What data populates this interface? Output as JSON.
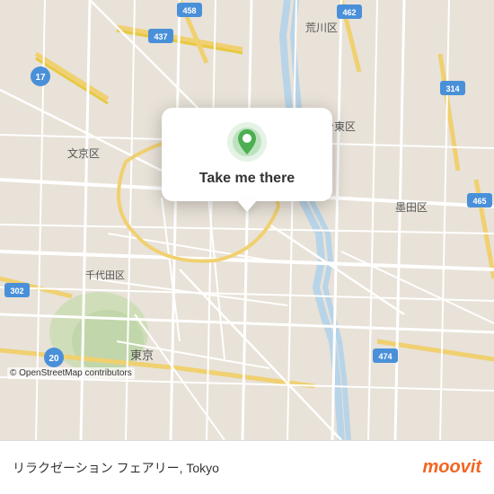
{
  "map": {
    "credit": "© OpenStreetMap contributors",
    "center_lat": 35.712,
    "center_lng": 139.77
  },
  "popup": {
    "button_label": "Take me there",
    "pin_color": "#4CAF50"
  },
  "bottom_bar": {
    "place_name": "リラクゼーション フェアリー, Tokyo",
    "logo_text": "moovit"
  }
}
